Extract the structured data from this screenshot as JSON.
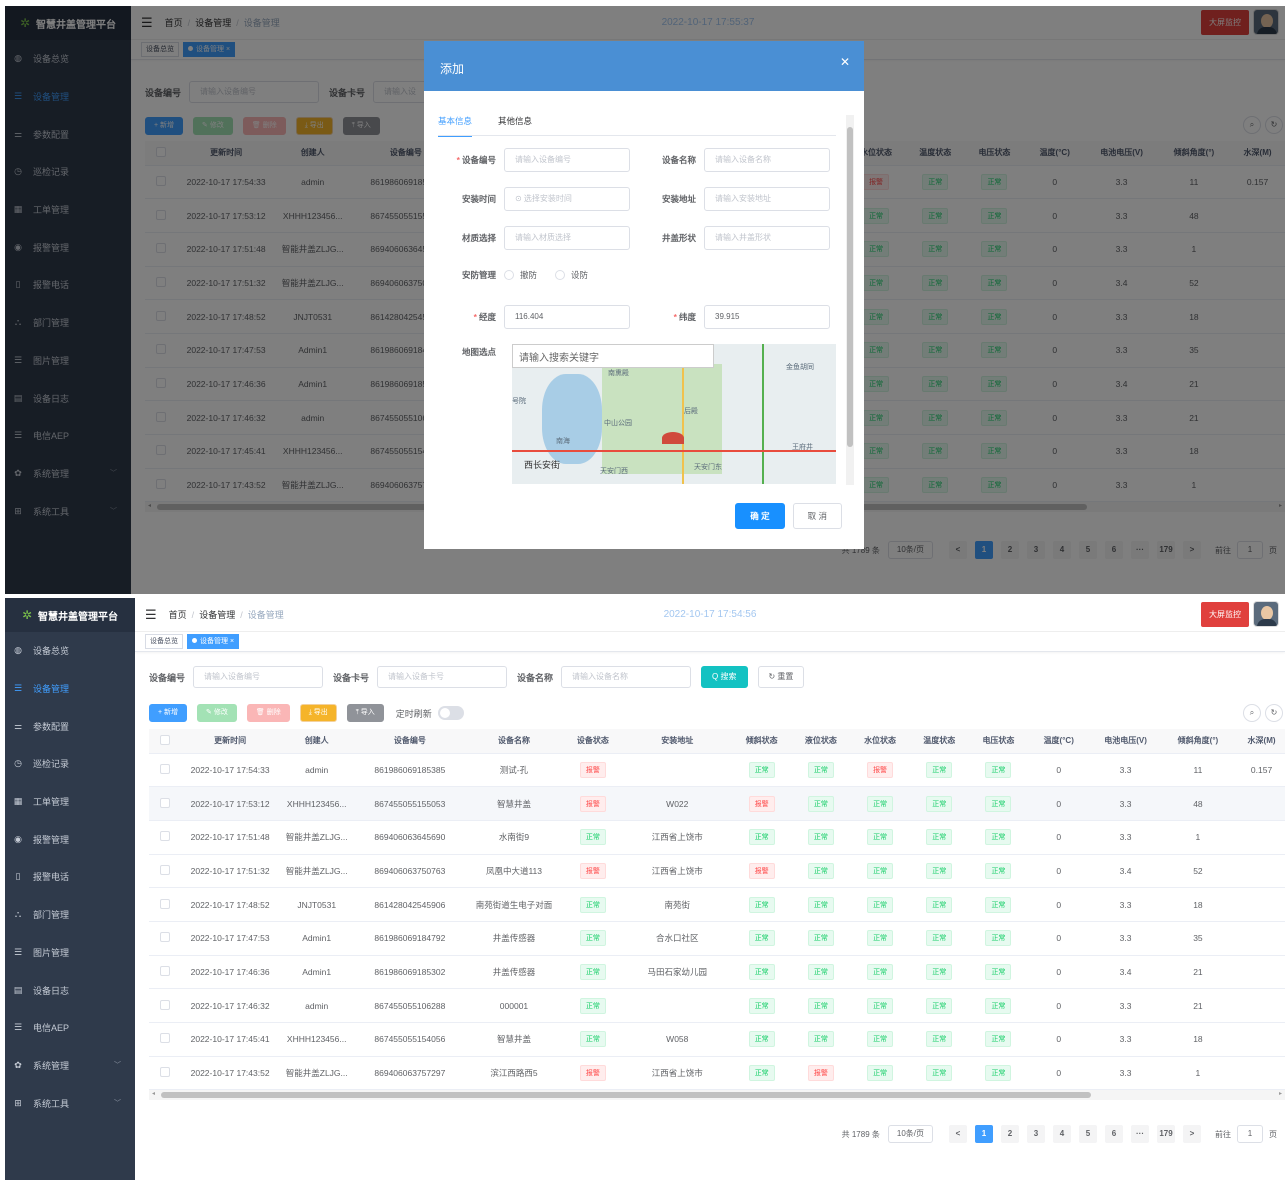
{
  "app": {
    "logo_text": "智慧井盖管理平台",
    "clock1": "2022-10-17 17:55:37",
    "clock2": "2022-10-17 17:54:56",
    "bigscreen": "大屏监控"
  },
  "breadcrumb": {
    "home": "首页",
    "level1": "设备管理",
    "level2": "设备管理"
  },
  "tags": {
    "overview": "设备总览",
    "device": "设备管理"
  },
  "menu": [
    {
      "label": "设备总览",
      "icon": "dashboard-icon"
    },
    {
      "label": "设备管理",
      "icon": "list-icon"
    },
    {
      "label": "参数配置",
      "icon": "settings-list-icon"
    },
    {
      "label": "巡检记录",
      "icon": "history-icon"
    },
    {
      "label": "工单管理",
      "icon": "grid-icon"
    },
    {
      "label": "报警管理",
      "icon": "alarm-icon"
    },
    {
      "label": "报警电话",
      "icon": "phone-icon"
    },
    {
      "label": "部门管理",
      "icon": "org-icon"
    },
    {
      "label": "图片管理",
      "icon": "list-icon"
    },
    {
      "label": "设备日志",
      "icon": "log-icon"
    },
    {
      "label": "电信AEP",
      "icon": "list-icon"
    },
    {
      "label": "系统管理",
      "icon": "gear-icon"
    },
    {
      "label": "系统工具",
      "icon": "tools-icon"
    }
  ],
  "search": {
    "code_label": "设备编号",
    "code_ph": "请输入设备编号",
    "card_label": "设备卡号",
    "card_ph": "请输入设备卡号",
    "card_ph_short": "请输入设",
    "name_label": "设备名称",
    "name_ph": "请输入设备名称",
    "search_btn": "Q 搜索",
    "reset_btn": "↻ 重置"
  },
  "toolbar": {
    "add": "+ 新增",
    "edit": "✎ 修改",
    "del": "🗑 删除",
    "exp": "⤓ 导出",
    "imp": "⤒ 导入",
    "refresh": "定时刷新"
  },
  "table": {
    "headers": [
      "更新时间",
      "创建人",
      "设备编号",
      "设备名称",
      "设备状态",
      "安装地址",
      "倾斜状态",
      "液位状态",
      "水位状态",
      "温度状态",
      "电压状态",
      "温度(°C)",
      "电池电压(V)",
      "倾斜角度(°)",
      "水深(M)"
    ],
    "rows": [
      {
        "time": "2022-10-17 17:54:33",
        "creator": "admin",
        "code": "861986069185385",
        "name": "测试-孔",
        "status": "报警",
        "addr": "",
        "tilt": "正常",
        "liquid": "正常",
        "water": "报警",
        "temp_st": "正常",
        "volt_st": "正常",
        "temp": "0",
        "batt": "3.3",
        "angle": "11",
        "depth": "0.157"
      },
      {
        "time": "2022-10-17 17:53:12",
        "creator": "XHHH123456...",
        "code": "867455055155053",
        "name": "智慧井盖",
        "status": "报警",
        "addr": "W022",
        "tilt": "报警",
        "liquid": "正常",
        "water": "正常",
        "temp_st": "正常",
        "volt_st": "正常",
        "temp": "0",
        "batt": "3.3",
        "angle": "48",
        "depth": ""
      },
      {
        "time": "2022-10-17 17:51:48",
        "creator": "智能井盖ZLJG...",
        "code": "869406063645690",
        "name": "水南街9",
        "status": "正常",
        "addr": "江西省上饶市",
        "tilt": "正常",
        "liquid": "正常",
        "water": "正常",
        "temp_st": "正常",
        "volt_st": "正常",
        "temp": "0",
        "batt": "3.3",
        "angle": "1",
        "depth": ""
      },
      {
        "time": "2022-10-17 17:51:32",
        "creator": "智能井盖ZLJG...",
        "code": "869406063750763",
        "name": "凤凰中大道113",
        "status": "报警",
        "addr": "江西省上饶市",
        "tilt": "报警",
        "liquid": "正常",
        "water": "正常",
        "temp_st": "正常",
        "volt_st": "正常",
        "temp": "0",
        "batt": "3.4",
        "angle": "52",
        "depth": ""
      },
      {
        "time": "2022-10-17 17:48:52",
        "creator": "JNJT0531",
        "code": "861428042545906",
        "name": "南苑街道生电子对面",
        "status": "正常",
        "addr": "南苑街",
        "tilt": "正常",
        "liquid": "正常",
        "water": "正常",
        "temp_st": "正常",
        "volt_st": "正常",
        "temp": "0",
        "batt": "3.3",
        "angle": "18",
        "depth": ""
      },
      {
        "time": "2022-10-17 17:47:53",
        "creator": "Admin1",
        "code": "861986069184792",
        "name": "井盖传感器",
        "status": "正常",
        "addr": "合水口社区",
        "tilt": "正常",
        "liquid": "正常",
        "water": "正常",
        "temp_st": "正常",
        "volt_st": "正常",
        "temp": "0",
        "batt": "3.3",
        "angle": "35",
        "depth": ""
      },
      {
        "time": "2022-10-17 17:46:36",
        "creator": "Admin1",
        "code": "861986069185302",
        "name": "井盖传感器",
        "status": "正常",
        "addr": "马田石家幼儿园",
        "tilt": "正常",
        "liquid": "正常",
        "water": "正常",
        "temp_st": "正常",
        "volt_st": "正常",
        "temp": "0",
        "batt": "3.4",
        "angle": "21",
        "depth": ""
      },
      {
        "time": "2022-10-17 17:46:32",
        "creator": "admin",
        "code": "867455055106288",
        "name": "000001",
        "status": "正常",
        "addr": "",
        "tilt": "正常",
        "liquid": "正常",
        "water": "正常",
        "temp_st": "正常",
        "volt_st": "正常",
        "temp": "0",
        "batt": "3.3",
        "angle": "21",
        "depth": ""
      },
      {
        "time": "2022-10-17 17:45:41",
        "creator": "XHHH123456...",
        "code": "867455055154056",
        "name": "智慧井盖",
        "status": "正常",
        "addr": "W058",
        "tilt": "正常",
        "liquid": "正常",
        "water": "正常",
        "temp_st": "正常",
        "volt_st": "正常",
        "temp": "0",
        "batt": "3.3",
        "angle": "18",
        "depth": ""
      },
      {
        "time": "2022-10-17 17:43:52",
        "creator": "智能井盖ZLJG...",
        "code": "869406063757297",
        "name": "滨江西路西5",
        "status": "报警",
        "addr": "江西省上饶市",
        "tilt": "正常",
        "liquid": "报警",
        "water": "正常",
        "temp_st": "正常",
        "volt_st": "正常",
        "temp": "0",
        "batt": "3.3",
        "angle": "1",
        "depth": ""
      }
    ]
  },
  "pager": {
    "total": "共 1789 条",
    "total_partial": "共 1789 条",
    "size": "10条/页",
    "pages": [
      "1",
      "2",
      "3",
      "4",
      "5",
      "6",
      "···",
      "179"
    ],
    "goto": "前往",
    "page": "1",
    "unit": "页",
    "prev": "<",
    "next": ">"
  },
  "dialog": {
    "title": "添加",
    "tab_basic": "基本信息",
    "tab_other": "其他信息",
    "code_label": "设备编号",
    "code_ph": "请输入设备编号",
    "name_label": "设备名称",
    "name_ph": "请输入设备名称",
    "time_label": "安装时间",
    "time_ph": "⊙ 选择安装时间",
    "addr_label": "安装地址",
    "addr_ph": "请输入安装地址",
    "mat_label": "材质选择",
    "mat_ph": "请输入材质选择",
    "shape_label": "井盖形状",
    "shape_ph": "请输入井盖形状",
    "guard_label": "安防管理",
    "guard_off": "撤防",
    "guard_on": "设防",
    "lng_label": "经度",
    "lng": "116.404",
    "lat_label": "纬度",
    "lat": "39.915",
    "map_label": "地图选点",
    "map_search": "请输入搜索关键字",
    "map_labels": [
      "金鱼胡同",
      "南熏殿",
      "后殿",
      "中山公园",
      "王府井",
      "西长安街",
      "南海",
      "天安门西",
      "天安门东",
      "号院"
    ],
    "ok": "确 定",
    "cancel": "取 消"
  },
  "colors": {
    "sidebar": "#2f3a4b",
    "accent": "#409eff",
    "ok": "#13ce66",
    "alarm": "#ff4949",
    "dialog_header": "#4a8fd4"
  }
}
